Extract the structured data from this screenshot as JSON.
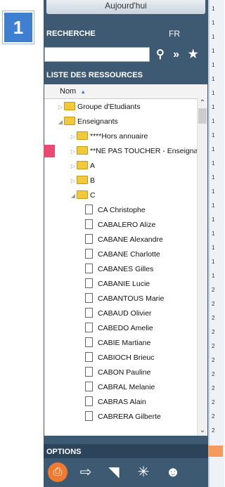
{
  "step_badge": "1",
  "today_button": "Aujourd'hui",
  "search": {
    "title": "RECHERCHE",
    "lang": "FR",
    "placeholder": "",
    "icons": [
      "search-icon",
      "double-chevron-icon",
      "star-icon"
    ]
  },
  "resources": {
    "title": "LISTE DES RESSOURCES",
    "column_header": "Nom",
    "rows": [
      {
        "label": "Groupe d'Etudiants",
        "type": "folder",
        "level": 1,
        "expanded": false
      },
      {
        "label": "Enseignants",
        "type": "folder",
        "level": 1,
        "expanded": true
      },
      {
        "label": "****Hors annuaire",
        "type": "folder",
        "level": 2,
        "expanded": false
      },
      {
        "label": "**NE PAS TOUCHER - Enseignant",
        "type": "folder",
        "level": 2,
        "expanded": false
      },
      {
        "label": "A",
        "type": "folder",
        "level": 2,
        "expanded": false
      },
      {
        "label": "B",
        "type": "folder",
        "level": 2,
        "expanded": false
      },
      {
        "label": "C",
        "type": "folder",
        "level": 2,
        "expanded": true
      },
      {
        "label": "CA Christophe",
        "type": "doc",
        "level": 3
      },
      {
        "label": "CABALERO Alize",
        "type": "doc",
        "level": 3
      },
      {
        "label": "CABANE Alexandre",
        "type": "doc",
        "level": 3
      },
      {
        "label": "CABANE Charlotte",
        "type": "doc",
        "level": 3
      },
      {
        "label": "CABANES Gilles",
        "type": "doc",
        "level": 3
      },
      {
        "label": "CABANIE Lucie",
        "type": "doc",
        "level": 3
      },
      {
        "label": "CABANTOUS Marie",
        "type": "doc",
        "level": 3
      },
      {
        "label": "CABAUD Olivier",
        "type": "doc",
        "level": 3
      },
      {
        "label": "CABEDO Amelie",
        "type": "doc",
        "level": 3
      },
      {
        "label": "CABIE Martiane",
        "type": "doc",
        "level": 3
      },
      {
        "label": "CABIOCH Brieuc",
        "type": "doc",
        "level": 3
      },
      {
        "label": "CABON Pauline",
        "type": "doc",
        "level": 3
      },
      {
        "label": "CABRAL Melanie",
        "type": "doc",
        "level": 3
      },
      {
        "label": "CABRAS Alain",
        "type": "doc",
        "level": 3
      },
      {
        "label": "CABRERA Gilberte",
        "type": "doc",
        "level": 3
      }
    ]
  },
  "options": {
    "title": "OPTIONS",
    "icons": [
      "print-icon",
      "export-icon",
      "rss-icon",
      "magic-wand-icon",
      "user-icon"
    ]
  },
  "colors": {
    "panel": "#3e5a72",
    "accent_orange": "#f07a2f",
    "pink_marker": "#e84a72",
    "badge_blue": "#3f7fcf"
  }
}
